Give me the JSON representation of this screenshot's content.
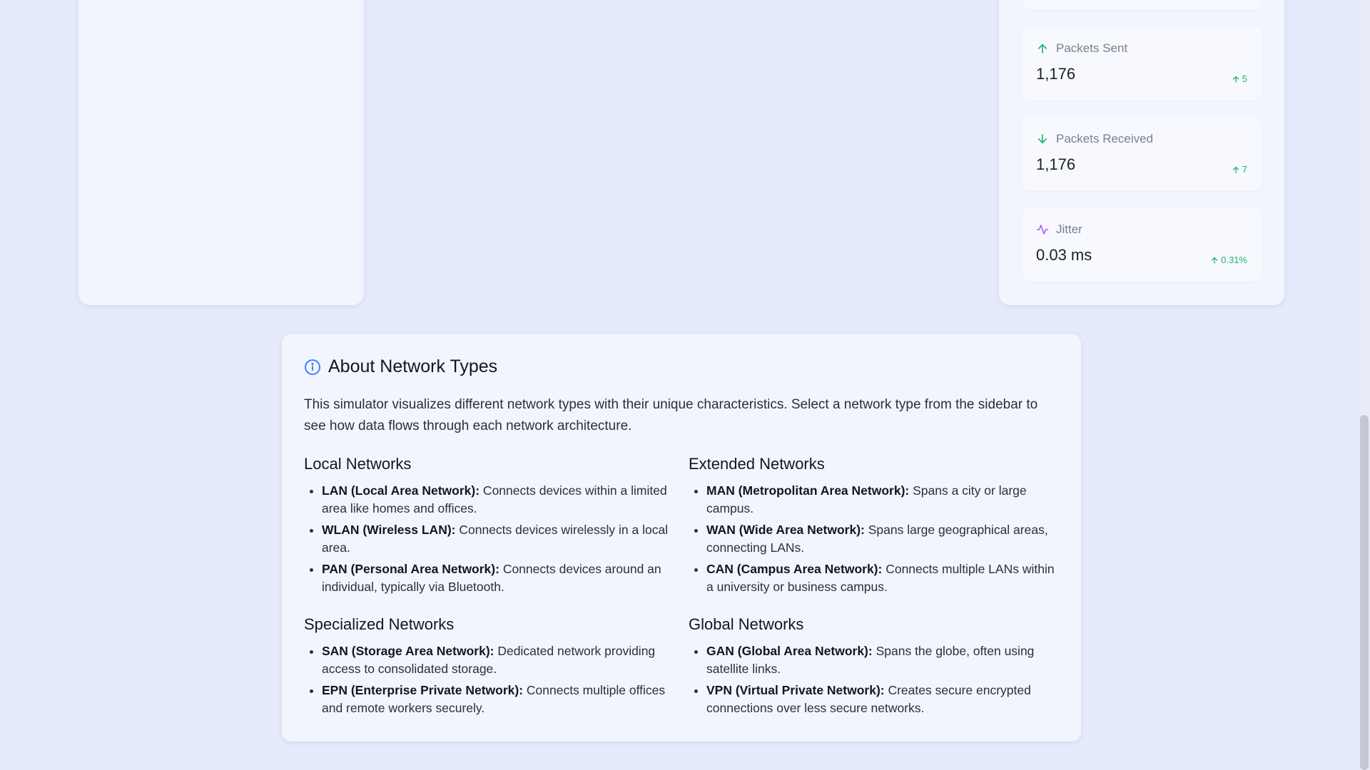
{
  "stats": [
    {
      "icon": "arrow-up-icon",
      "label": "Packets Sent",
      "value": "1,176",
      "delta": "5"
    },
    {
      "icon": "arrow-down-icon",
      "label": "Packets Received",
      "value": "1,176",
      "delta": "7"
    },
    {
      "icon": "activity-icon",
      "label": "Jitter",
      "value": "0.03 ms",
      "delta": "0.31%"
    }
  ],
  "colors": {
    "positive": "#1fb36a",
    "accent_blue": "#3b82f6",
    "accent_purple": "#a855f7"
  },
  "about": {
    "icon": "info-icon",
    "title": "About Network Types",
    "description": "This simulator visualizes different network types with their unique characteristics. Select a network type from the sidebar to see how data flows through each network architecture.",
    "sections": [
      {
        "title": "Local Networks",
        "items": [
          {
            "term": "LAN (Local Area Network):",
            "desc": " Connects devices within a limited area like homes and offices."
          },
          {
            "term": "WLAN (Wireless LAN):",
            "desc": " Connects devices wirelessly in a local area."
          },
          {
            "term": "PAN (Personal Area Network):",
            "desc": " Connects devices around an individual, typically via Bluetooth."
          }
        ]
      },
      {
        "title": "Extended Networks",
        "items": [
          {
            "term": "MAN (Metropolitan Area Network):",
            "desc": " Spans a city or large campus."
          },
          {
            "term": "WAN (Wide Area Network):",
            "desc": " Spans large geographical areas, connecting LANs."
          },
          {
            "term": "CAN (Campus Area Network):",
            "desc": " Connects multiple LANs within a university or business campus."
          }
        ]
      },
      {
        "title": "Specialized Networks",
        "items": [
          {
            "term": "SAN (Storage Area Network):",
            "desc": " Dedicated network providing access to consolidated storage."
          },
          {
            "term": "EPN (Enterprise Private Network):",
            "desc": " Connects multiple offices and remote workers securely."
          }
        ]
      },
      {
        "title": "Global Networks",
        "items": [
          {
            "term": "GAN (Global Area Network):",
            "desc": " Spans the globe, often using satellite links."
          },
          {
            "term": "VPN (Virtual Private Network):",
            "desc": " Creates secure encrypted connections over less secure networks."
          }
        ]
      }
    ]
  }
}
